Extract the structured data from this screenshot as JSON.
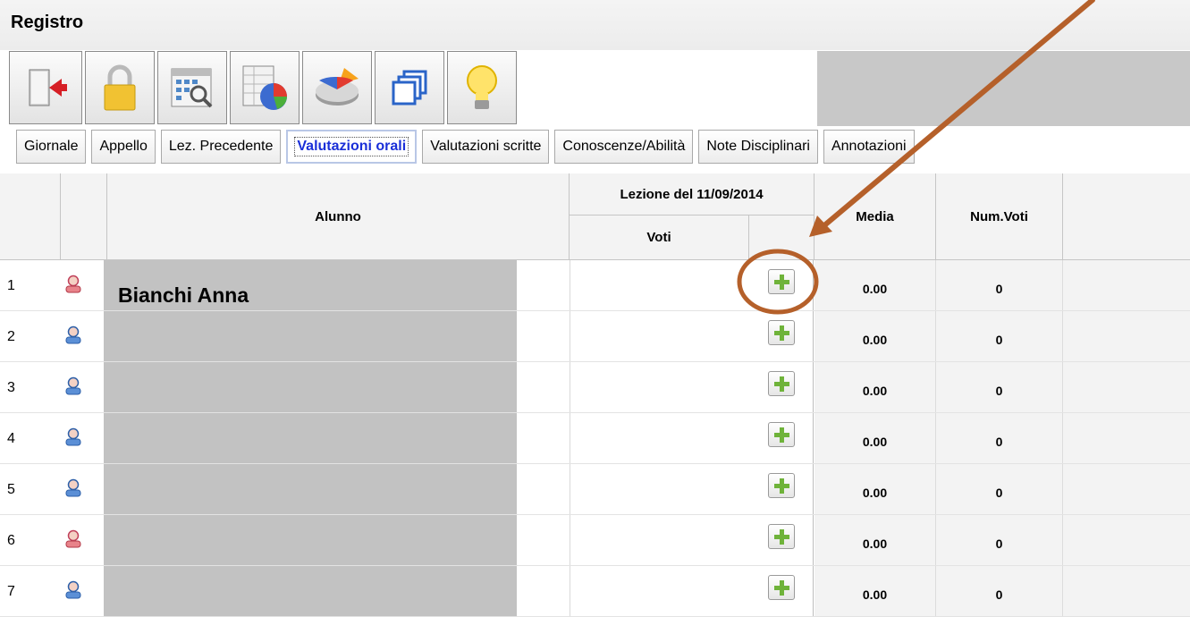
{
  "window": {
    "title": "Registro"
  },
  "toolbar": {
    "buttons": [
      {
        "icon": "exit-door-icon"
      },
      {
        "icon": "lock-icon"
      },
      {
        "icon": "calendar-search-icon"
      },
      {
        "icon": "spreadsheet-chart-icon"
      },
      {
        "icon": "pie-chart-icon"
      },
      {
        "icon": "windows-icon"
      },
      {
        "icon": "lightbulb-icon"
      }
    ]
  },
  "tabs": [
    {
      "label": "Giornale"
    },
    {
      "label": "Appello"
    },
    {
      "label": "Lez. Precedente"
    },
    {
      "label": "Valutazioni orali",
      "active": true
    },
    {
      "label": "Valutazioni scritte"
    },
    {
      "label": "Conoscenze/Abilità"
    },
    {
      "label": "Note Disciplinari"
    },
    {
      "label": "Annotazioni"
    }
  ],
  "table": {
    "headers": {
      "alunno": "Alunno",
      "lezione": "Lezione del 11/09/2014",
      "voti": "Voti",
      "media": "Media",
      "num_voti": "Num.Voti"
    },
    "rows": [
      {
        "num": "1",
        "gender": "female",
        "name": "Bianchi Anna",
        "media": "0.00",
        "num_voti": "0"
      },
      {
        "num": "2",
        "gender": "male",
        "name": "",
        "media": "0.00",
        "num_voti": "0"
      },
      {
        "num": "3",
        "gender": "male",
        "name": "",
        "media": "0.00",
        "num_voti": "0"
      },
      {
        "num": "4",
        "gender": "male",
        "name": "",
        "media": "0.00",
        "num_voti": "0"
      },
      {
        "num": "5",
        "gender": "male",
        "name": "",
        "media": "0.00",
        "num_voti": "0"
      },
      {
        "num": "6",
        "gender": "female",
        "name": "",
        "media": "0.00",
        "num_voti": "0"
      },
      {
        "num": "7",
        "gender": "male",
        "name": "",
        "media": "0.00",
        "num_voti": "0"
      }
    ]
  },
  "colors": {
    "active_tab": "#1a2fd8",
    "annotation": "#b5602a",
    "add_plus": "#6fb33a",
    "female": "#e8838a",
    "male": "#5b8fd6"
  }
}
